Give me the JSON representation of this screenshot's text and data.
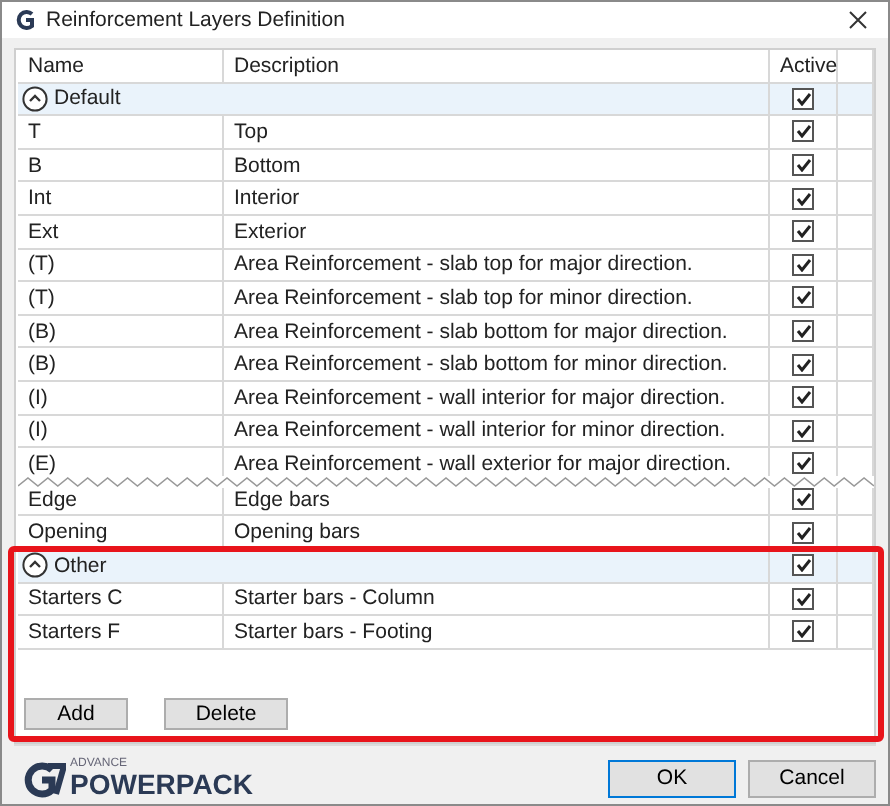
{
  "window": {
    "title": "Reinforcement Layers Definition"
  },
  "table": {
    "columns": [
      "Name",
      "Description",
      "Active"
    ],
    "groups": [
      {
        "label": "Default",
        "expanded": true,
        "active": true,
        "highlighted": false,
        "rows": [
          {
            "kind": "row",
            "name": "T",
            "description": "Top",
            "active": true
          },
          {
            "kind": "row",
            "name": "B",
            "description": "Bottom",
            "active": true
          },
          {
            "kind": "row",
            "name": "Int",
            "description": "Interior",
            "active": true
          },
          {
            "kind": "row",
            "name": "Ext",
            "description": "Exterior",
            "active": true
          },
          {
            "kind": "row",
            "name": "(T)",
            "description": "Area Reinforcement - slab top for major direction.",
            "active": true
          },
          {
            "kind": "row",
            "name": "(T)",
            "description": "Area Reinforcement - slab top for minor direction.",
            "active": true
          },
          {
            "kind": "row",
            "name": "(B)",
            "description": "Area Reinforcement - slab bottom for major direction.",
            "active": true
          },
          {
            "kind": "row",
            "name": "(B)",
            "description": "Area Reinforcement - slab bottom for minor direction.",
            "active": true
          },
          {
            "kind": "row",
            "name": "(I)",
            "description": "Area Reinforcement - wall interior for major direction.",
            "active": true
          },
          {
            "kind": "row",
            "name": "(I)",
            "description": "Area Reinforcement - wall interior for minor direction.",
            "active": true
          },
          {
            "kind": "row",
            "name": "(E)",
            "description": "Area Reinforcement - wall exterior for major direction.",
            "active": true
          },
          {
            "kind": "break"
          },
          {
            "kind": "row",
            "name": "Edge",
            "description": "Edge bars",
            "active": true
          },
          {
            "kind": "row",
            "name": "Opening",
            "description": "Opening bars",
            "active": true
          }
        ]
      },
      {
        "label": "Other",
        "expanded": true,
        "active": true,
        "highlighted": true,
        "rows": [
          {
            "kind": "row",
            "name": "Starters C",
            "description": "Starter bars - Column",
            "active": true
          },
          {
            "kind": "row",
            "name": "Starters F",
            "description": "Starter bars - Footing",
            "active": true
          }
        ]
      }
    ]
  },
  "table_buttons": [
    "Add",
    "Delete"
  ],
  "logo": {
    "small": "ADVANCE",
    "large": "POWERPACK"
  },
  "dialog_buttons": [
    {
      "label": "OK",
      "default": true
    },
    {
      "label": "Cancel",
      "default": false
    }
  ]
}
